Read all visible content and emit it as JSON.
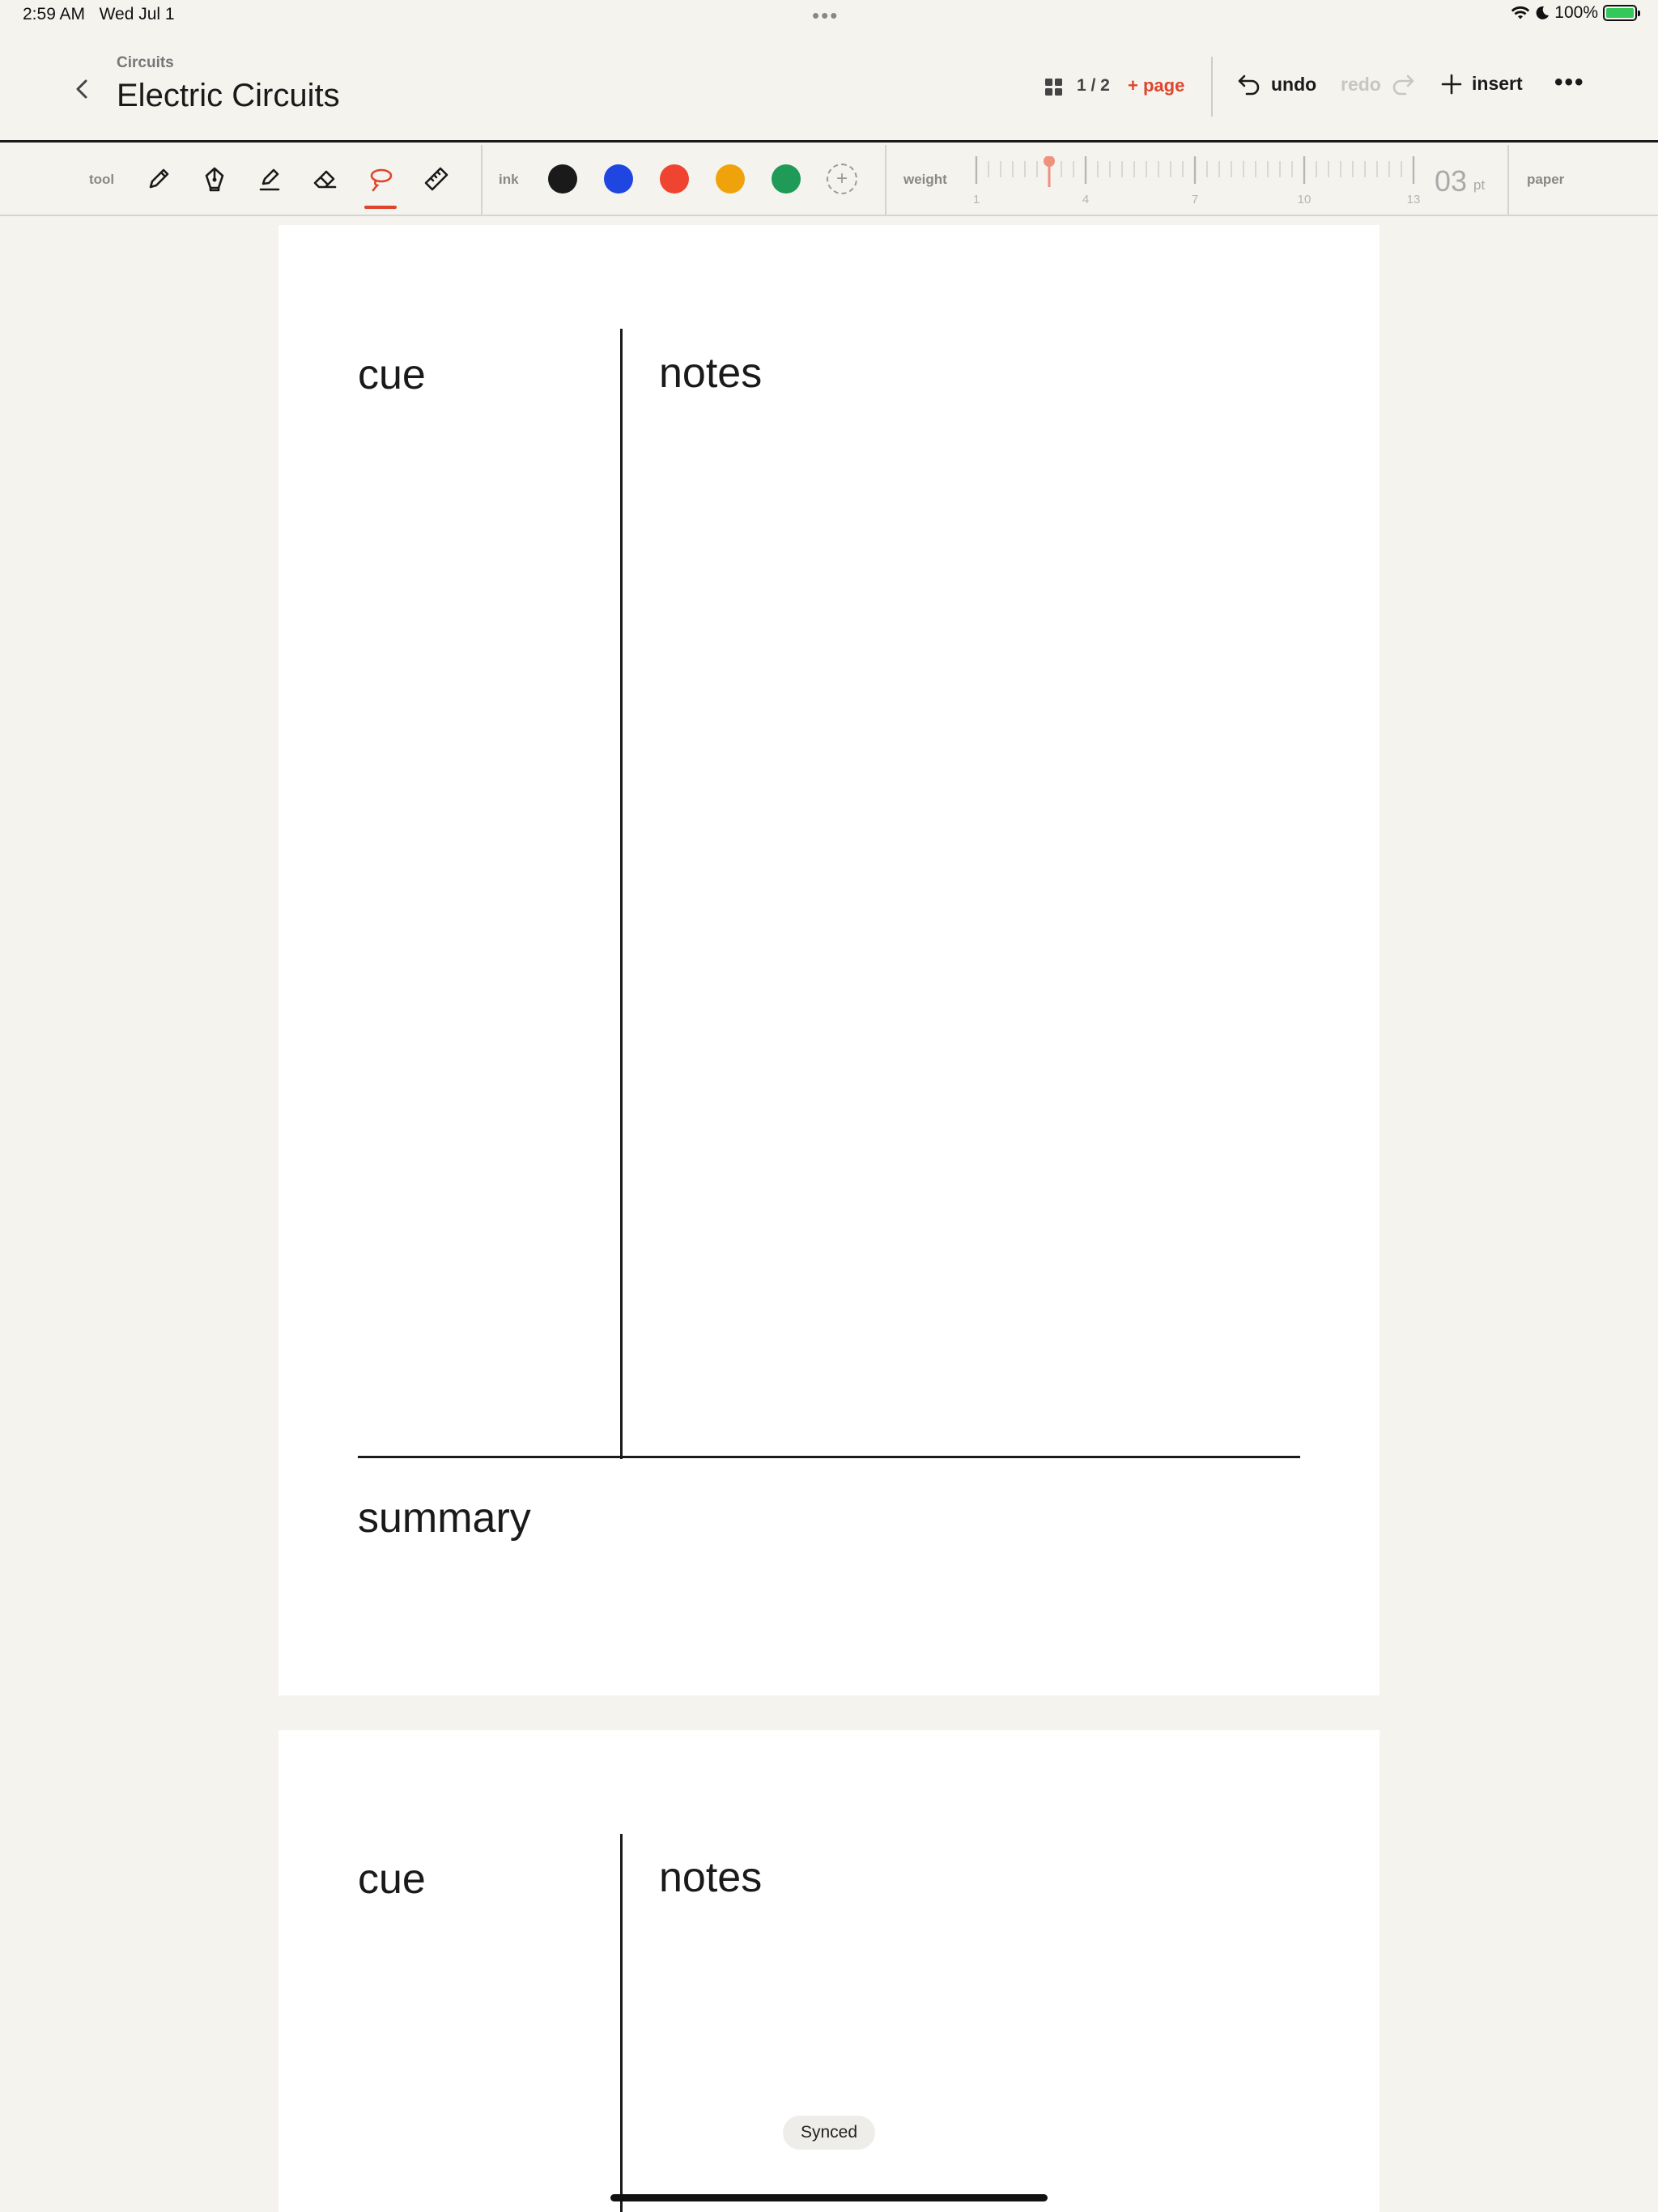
{
  "status_bar": {
    "time": "2:59 AM",
    "date": "Wed Jul 1",
    "battery_percent": "100%",
    "battery_level": 1.0,
    "icons": [
      "wifi-icon",
      "moon-icon",
      "battery-charging-icon"
    ]
  },
  "header": {
    "breadcrumb": "Circuits",
    "title": "Electric Circuits",
    "page_indicator": "1 / 2",
    "add_page_label": "+ page",
    "undo_label": "undo",
    "redo_label": "redo",
    "insert_label": "insert",
    "accent_color": "#e0442c"
  },
  "toolbar": {
    "tool_label": "tool",
    "tools": [
      {
        "name": "pencil",
        "icon": "pencil-icon"
      },
      {
        "name": "fountain-pen",
        "icon": "fountain-pen-icon"
      },
      {
        "name": "highlighter",
        "icon": "highlighter-icon"
      },
      {
        "name": "eraser",
        "icon": "eraser-icon"
      },
      {
        "name": "lasso",
        "icon": "lasso-icon",
        "selected": true
      },
      {
        "name": "ruler",
        "icon": "ruler-icon"
      }
    ],
    "ink_label": "ink",
    "ink_colors": [
      "#1a1a1a",
      "#1f46e0",
      "#ef4530",
      "#f0a20b",
      "#1f9a57"
    ],
    "weight_label": "weight",
    "weight_ticks": [
      "1",
      "4",
      "7",
      "10",
      "13"
    ],
    "weight_value": "03",
    "weight_unit": "pt",
    "weight_setting": 3,
    "paper_label": "paper"
  },
  "pages": [
    {
      "cue": "cue",
      "notes": "notes",
      "summary": "summary"
    },
    {
      "cue": "cue",
      "notes": "notes"
    }
  ],
  "toast": "Synced"
}
